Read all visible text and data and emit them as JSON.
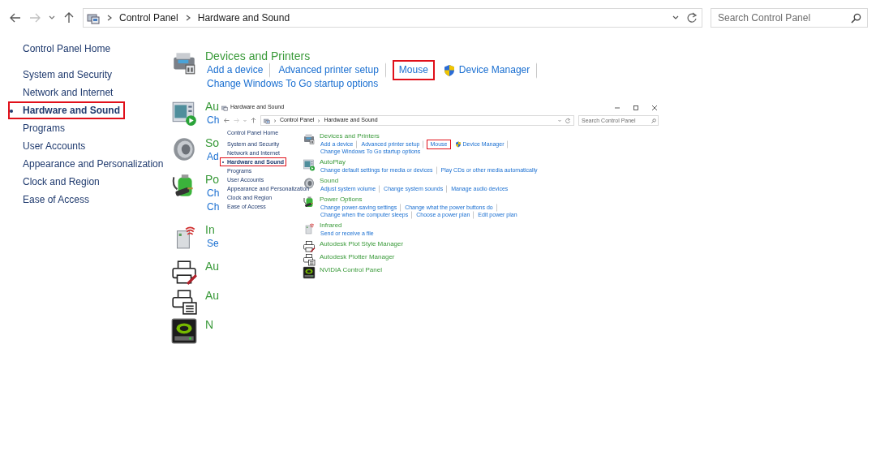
{
  "address_bar": {
    "path": [
      "Control Panel",
      "Hardware and Sound"
    ]
  },
  "search": {
    "placeholder": "Search Control Panel"
  },
  "sidebar": {
    "home": "Control Panel Home",
    "items": [
      {
        "label": "System and Security",
        "selected": false,
        "boxed": false
      },
      {
        "label": "Network and Internet",
        "selected": false,
        "boxed": false
      },
      {
        "label": "Hardware and Sound",
        "selected": true,
        "boxed": true
      },
      {
        "label": "Programs",
        "selected": false,
        "boxed": false
      },
      {
        "label": "User Accounts",
        "selected": false,
        "boxed": false
      },
      {
        "label": "Appearance and Personalization",
        "selected": false,
        "boxed": false
      },
      {
        "label": "Clock and Region",
        "selected": false,
        "boxed": false
      },
      {
        "label": "Ease of Access",
        "selected": false,
        "boxed": false
      }
    ]
  },
  "sections": [
    {
      "title": "Devices and Printers",
      "lines": [
        [
          {
            "label": "Add a device",
            "boxed": false,
            "shield": false,
            "separator_after": true
          },
          {
            "label": "Advanced printer setup",
            "boxed": false,
            "shield": false,
            "separator_after": true
          },
          {
            "label": "Mouse",
            "boxed": true,
            "shield": false,
            "separator_after": false
          },
          {
            "label": "Device Manager",
            "boxed": false,
            "shield": true,
            "separator_after": true
          }
        ],
        [
          {
            "label": "Change Windows To Go startup options",
            "boxed": false,
            "shield": false,
            "separator_after": false
          }
        ]
      ]
    },
    {
      "title": "Au",
      "lines": [
        [
          {
            "label": "Ch",
            "boxed": false,
            "shield": false,
            "separator_after": false
          }
        ]
      ]
    },
    {
      "title": "So",
      "lines": [
        [
          {
            "label": "Ad",
            "boxed": false,
            "shield": false,
            "separator_after": false
          }
        ]
      ]
    },
    {
      "title": "Po",
      "lines": [
        [
          {
            "label": "Ch",
            "boxed": false,
            "shield": false,
            "separator_after": false
          }
        ],
        [
          {
            "label": "Ch",
            "boxed": false,
            "shield": false,
            "separator_after": false
          }
        ]
      ]
    },
    {
      "title": "In",
      "lines": [
        [
          {
            "label": "Se",
            "boxed": false,
            "shield": false,
            "separator_after": false
          }
        ]
      ]
    },
    {
      "title": "Au"
    },
    {
      "title": "Au"
    },
    {
      "title": "N"
    }
  ],
  "inset_window": {
    "title": "Hardware and Sound",
    "address_bar": {
      "path": [
        "Control Panel",
        "Hardware and Sound"
      ]
    },
    "search": {
      "placeholder": "Search Control Panel"
    },
    "sidebar": {
      "home": "Control Panel Home",
      "items": [
        {
          "label": "System and Security",
          "selected": false,
          "boxed": false
        },
        {
          "label": "Network and Internet",
          "selected": false,
          "boxed": false
        },
        {
          "label": "Hardware and Sound",
          "selected": true,
          "boxed": true
        },
        {
          "label": "Programs",
          "selected": false,
          "boxed": false
        },
        {
          "label": "User Accounts",
          "selected": false,
          "boxed": false
        },
        {
          "label": "Appearance and Personalization",
          "selected": false,
          "boxed": false
        },
        {
          "label": "Clock and Region",
          "selected": false,
          "boxed": false
        },
        {
          "label": "Ease of Access",
          "selected": false,
          "boxed": false
        }
      ]
    },
    "sections": [
      {
        "title": "Devices and Printers",
        "lines": [
          [
            {
              "label": "Add a device",
              "boxed": false,
              "shield": false,
              "separator_after": true
            },
            {
              "label": "Advanced printer setup",
              "boxed": false,
              "shield": false,
              "separator_after": true
            },
            {
              "label": "Mouse",
              "boxed": true,
              "shield": false,
              "separator_after": false
            },
            {
              "label": "Device Manager",
              "boxed": false,
              "shield": true,
              "separator_after": true
            }
          ],
          [
            {
              "label": "Change Windows To Go startup options",
              "boxed": false,
              "shield": false,
              "separator_after": false
            }
          ]
        ]
      },
      {
        "title": "AutoPlay",
        "lines": [
          [
            {
              "label": "Change default settings for media or devices",
              "boxed": false,
              "shield": false,
              "separator_after": true
            },
            {
              "label": "Play CDs or other media automatically",
              "boxed": false,
              "shield": false,
              "separator_after": false
            }
          ]
        ]
      },
      {
        "title": "Sound",
        "lines": [
          [
            {
              "label": "Adjust system volume",
              "boxed": false,
              "shield": false,
              "separator_after": true
            },
            {
              "label": "Change system sounds",
              "boxed": false,
              "shield": false,
              "separator_after": true
            },
            {
              "label": "Manage audio devices",
              "boxed": false,
              "shield": false,
              "separator_after": false
            }
          ]
        ]
      },
      {
        "title": "Power Options",
        "lines": [
          [
            {
              "label": "Change power-saving settings",
              "boxed": false,
              "shield": false,
              "separator_after": true
            },
            {
              "label": "Change what the power buttons do",
              "boxed": false,
              "shield": false,
              "separator_after": true
            }
          ],
          [
            {
              "label": "Change when the computer sleeps",
              "boxed": false,
              "shield": false,
              "separator_after": true
            },
            {
              "label": "Choose a power plan",
              "boxed": false,
              "shield": false,
              "separator_after": true
            },
            {
              "label": "Edit power plan",
              "boxed": false,
              "shield": false,
              "separator_after": false
            }
          ]
        ]
      },
      {
        "title": "Infrared",
        "lines": [
          [
            {
              "label": "Send or receive a file",
              "boxed": false,
              "shield": false,
              "separator_after": false
            }
          ]
        ]
      },
      {
        "title": "Autodesk Plot Style Manager"
      },
      {
        "title": "Autodesk Plotter Manager"
      },
      {
        "title": "NVIDIA Control Panel"
      }
    ]
  }
}
